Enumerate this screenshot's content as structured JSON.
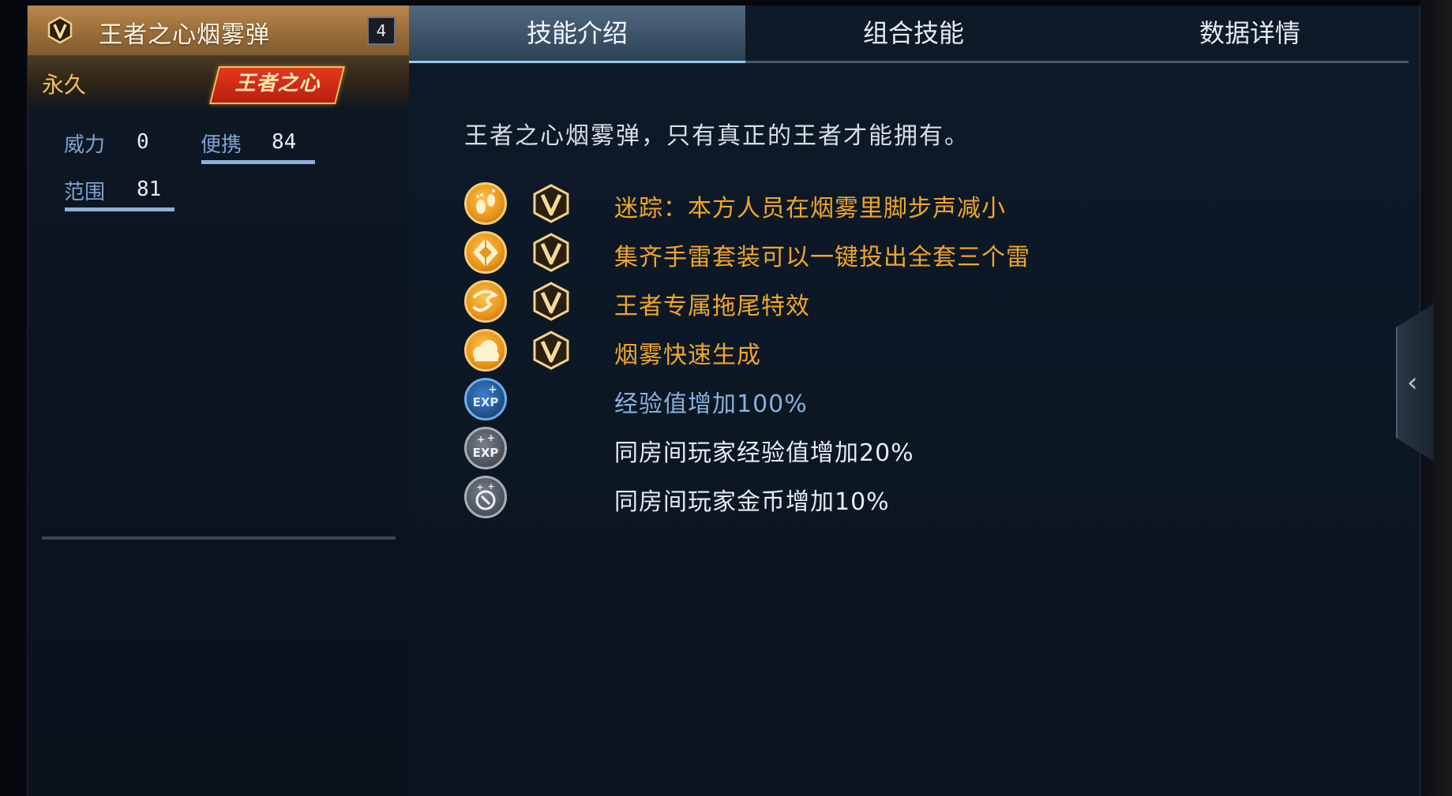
{
  "item": {
    "name": "王者之心烟雾弹",
    "level": "4",
    "duration": "永久",
    "brand": "王者之心"
  },
  "stats": {
    "power_label": "威力",
    "power_value": "0",
    "portable_label": "便携",
    "portable_value": "84",
    "range_label": "范围",
    "range_value": "81"
  },
  "tabs": [
    {
      "label": "技能介绍"
    },
    {
      "label": "组合技能"
    },
    {
      "label": "数据详情"
    }
  ],
  "intro": "王者之心烟雾弹，只有真正的王者才能拥有。",
  "skills": [
    {
      "icon": "footprint-icon",
      "vip": true,
      "text": "迷踪：本方人员在烟雾里脚步声减小",
      "color": "#f0a62a"
    },
    {
      "icon": "grenade-set-icon",
      "vip": true,
      "text": "集齐手雷套装可以一键投出全套三个雷",
      "color": "#f0a62a"
    },
    {
      "icon": "trail-icon",
      "vip": true,
      "text": "王者专属拖尾特效",
      "color": "#f0a62a"
    },
    {
      "icon": "smoke-icon",
      "vip": true,
      "text": "烟雾快速生成",
      "color": "#f0a62a"
    },
    {
      "icon": "exp-plus-icon",
      "vip": false,
      "text": "经验值增加100%",
      "color": "#8ab0dc"
    },
    {
      "icon": "room-exp-icon",
      "vip": false,
      "text": "同房间玩家经验值增加20%",
      "color": "#e8ecf2"
    },
    {
      "icon": "room-coin-icon",
      "vip": false,
      "text": "同房间玩家金币增加10%",
      "color": "#e8ecf2"
    }
  ],
  "colors": {
    "accent_gold": "#f0a62a",
    "exp_blue": "#8ab0dc",
    "active_tab": "#4f6880"
  }
}
